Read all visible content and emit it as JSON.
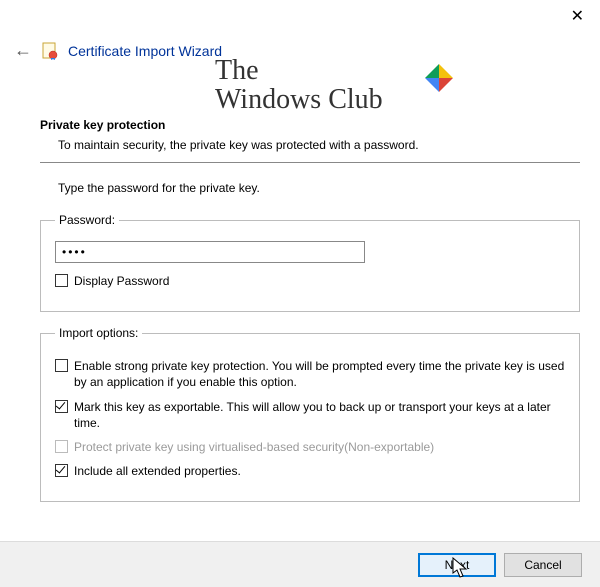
{
  "window": {
    "close_glyph": "✕",
    "back_glyph": "←",
    "title": "Certificate Import Wizard"
  },
  "watermark": {
    "line1": "The",
    "line2": "Windows Club"
  },
  "section": {
    "title": "Private key protection",
    "desc": "To maintain security, the private key was protected with a password."
  },
  "instruction": "Type the password for the private key.",
  "password": {
    "legend": "Password:",
    "value": "••••",
    "display_label": "Display Password",
    "display_checked": false
  },
  "options": {
    "legend": "Import options:",
    "strong": {
      "label": "Enable strong private key protection. You will be prompted every time the private key is used by an application if you enable this option.",
      "checked": false
    },
    "exportable": {
      "label": "Mark this key as exportable. This will allow you to back up or transport your keys at a later time.",
      "checked": true
    },
    "vbs": {
      "label": "Protect private key using virtualised-based security(Non-exportable)",
      "checked": false,
      "enabled": false
    },
    "extended": {
      "label": "Include all extended properties.",
      "checked": true
    }
  },
  "buttons": {
    "next": "Next",
    "cancel": "Cancel"
  }
}
